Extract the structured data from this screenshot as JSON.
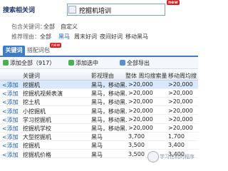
{
  "search": {
    "label": "搜索相关词",
    "value": "挖掘机培训",
    "badge": "new"
  },
  "filters": {
    "contains_label": "包含关键词：",
    "contains_options": [
      "全部",
      "自定义"
    ],
    "reason_label": "推荐理由：",
    "reason_options": [
      "全部",
      "黑马",
      "周末好词",
      "夜间好词",
      "移动黑马"
    ]
  },
  "tabs": {
    "keywords_label": "关键词",
    "alt_label": "搭配词包",
    "alt_badge": "new"
  },
  "toolbar": {
    "add_all_label": "添加全部（917）",
    "add_selected_label": "添加选中",
    "export_label": "全部导出"
  },
  "table": {
    "headers": {
      "keyword": "关键词",
      "reason": "影视理由",
      "monthly_search": "整体 周均搜索量",
      "mobile_search": "移动周均搜索量"
    },
    "add_label": "<添加",
    "rows": [
      {
        "keyword": "挖掘机",
        "reason": "黑马，移动黑...",
        "search": ">20,000",
        "mobile": ">20,000"
      },
      {
        "keyword": "挖掘机视频表演",
        "reason": "黑马，移动黑...",
        "search": ">20,000",
        "mobile": ">20,000"
      },
      {
        "keyword": "挖土机",
        "reason": "黑马，移动黑...",
        "search": ">20,000",
        "mobile": ">20,000"
      },
      {
        "keyword": "小挖掘机",
        "reason": "黑马，移动黑...",
        "search": ">20,000",
        "mobile": ">20,000"
      },
      {
        "keyword": "学习挖掘机",
        "reason": "黑马，移动黑...",
        "search": ">20,000",
        "mobile": ">20,000"
      },
      {
        "keyword": "挖掘机学校",
        "reason": "黑马，移动黑...",
        "search": ">20,000",
        "mobile": ">20,000"
      },
      {
        "keyword": "大型挖掘机",
        "reason": "黑马",
        "search": "3,700",
        "mobile": "1,700"
      },
      {
        "keyword": "挖掘机",
        "reason": "黑马",
        "search": "3,500",
        "mobile": "3,400"
      },
      {
        "keyword": "挖掘机价格",
        "reason": "黑马",
        "search": "3,500",
        "mobile": "3,400"
      }
    ]
  },
  "watermark": {
    "text": "学习挖机的程序"
  },
  "colors": {
    "accent": "#3d7cc9",
    "badge": "#d21f1f",
    "selected_row": "#d9e8fa"
  }
}
